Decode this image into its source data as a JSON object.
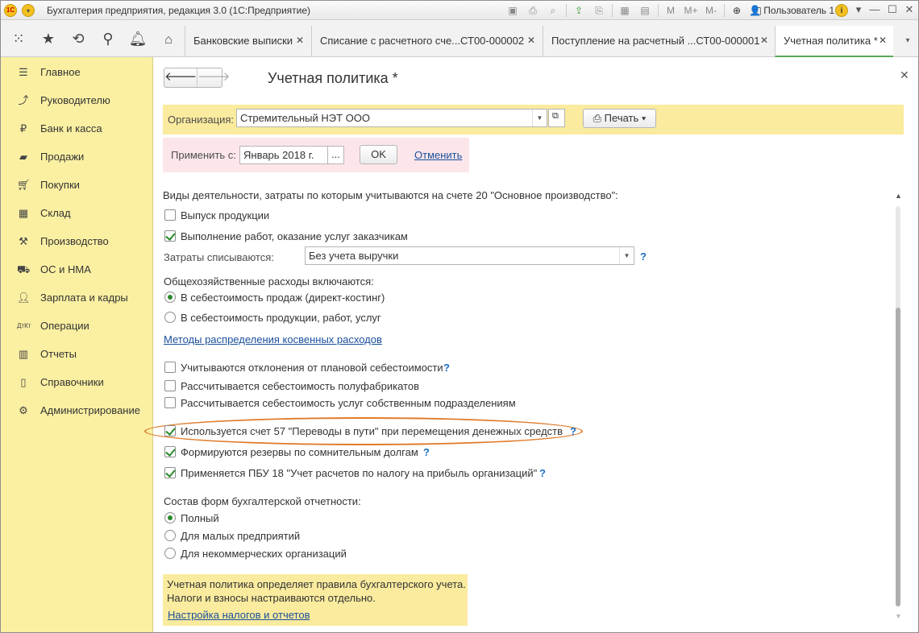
{
  "titlebar": {
    "logo": "1С",
    "title": "Бухгалтерия предприятия, редакция 3.0  (1С:Предприятие)",
    "user": "Пользователь 1",
    "icons": [
      "save-icon",
      "print-icon",
      "preview-icon",
      "upload-icon",
      "printer2-icon",
      "calculator-icon",
      "calendar-icon",
      "memory-m-icon",
      "memory-mplus-icon",
      "memory-mminus-icon",
      "zoom-icon",
      "window-icon"
    ],
    "memory_labels": [
      "M",
      "M+",
      "M-"
    ]
  },
  "navbar": {
    "tabs": [
      {
        "label": "Банковские выписки"
      },
      {
        "label": "Списание с расчетного сче...СТ00-000002"
      },
      {
        "label": "Поступление на расчетный ...СТ00-000001"
      },
      {
        "label": "Учетная политика *"
      }
    ]
  },
  "sidebar": {
    "items": [
      {
        "label": "Главное",
        "icon": "menu-icon"
      },
      {
        "label": "Руководителю",
        "icon": "chart-line-icon"
      },
      {
        "label": "Банк и касса",
        "icon": "ruble-icon"
      },
      {
        "label": "Продажи",
        "icon": "bag-icon"
      },
      {
        "label": "Покупки",
        "icon": "cart-icon"
      },
      {
        "label": "Склад",
        "icon": "warehouse-icon"
      },
      {
        "label": "Производство",
        "icon": "hammer-icon"
      },
      {
        "label": "ОС и НМА",
        "icon": "car-icon"
      },
      {
        "label": "Зарплата и кадры",
        "icon": "person-icon"
      },
      {
        "label": "Операции",
        "icon": "dt-kt-icon"
      },
      {
        "label": "Отчеты",
        "icon": "bar-chart-icon"
      },
      {
        "label": "Справочники",
        "icon": "book-icon"
      },
      {
        "label": "Администрирование",
        "icon": "gear-icon"
      }
    ]
  },
  "form": {
    "title": "Учетная политика *",
    "org_label": "Организация:",
    "org_value": "Стремительный НЭТ ООО",
    "print_label": "Печать",
    "apply_label": "Применить с:",
    "apply_value": "Январь 2018 г.",
    "ok_label": "OK",
    "cancel_label": "Отменить",
    "activities_header": "Виды деятельности, затраты по которым учитываются на счете 20 \"Основное производство\":",
    "cb_output": {
      "label": "Выпуск продукции",
      "checked": false
    },
    "cb_works": {
      "label": "Выполнение работ, оказание услуг заказчикам",
      "checked": true
    },
    "costs_label": "Затраты списываются:",
    "costs_value": "Без учета выручки",
    "overhead_header": "Общехозяйственные расходы включаются:",
    "rb_sales": {
      "label": "В себестоимость продаж (директ-костинг)",
      "checked": true
    },
    "rb_products": {
      "label": "В  себестоимость продукции, работ, услуг",
      "checked": false
    },
    "methods_link": "Методы распределения косвенных расходов",
    "cb_deviation": {
      "label": "Учитываются отклонения от плановой себестоимости",
      "checked": false
    },
    "cb_semi": {
      "label": "Рассчитывается себестоимость полуфабрикатов",
      "checked": false
    },
    "cb_own": {
      "label": "Рассчитывается себестоимость услуг собственным подразделениям",
      "checked": false
    },
    "cb_account57": {
      "label": "Используется счет 57 \"Переводы в пути\" при перемещения денежных средств",
      "checked": true
    },
    "cb_reserves": {
      "label": "Формируются резервы по сомнительным долгам",
      "checked": true
    },
    "cb_pbu18": {
      "label": "Применяется ПБУ 18 \"Учет расчетов по налогу на прибыль организаций\"",
      "checked": true
    },
    "reports_header": "Состав форм бухгалтерской отчетности:",
    "rb_full": {
      "label": "Полный",
      "checked": true
    },
    "rb_small": {
      "label": "Для малых предприятий",
      "checked": false
    },
    "rb_nonprofit": {
      "label": "Для некоммерческих организаций",
      "checked": false
    },
    "hint_line1": "Учетная политика определяет правила бухгалтерского учета.",
    "hint_line2": "Налоги и взносы настраиваются отдельно.",
    "hint_link": "Настройка налогов и отчетов",
    "help": "?"
  },
  "colors": {
    "sidebar_bg": "#fbf0a2",
    "org_bar_bg": "#faeb9e",
    "apply_bar_bg": "#fce6ea",
    "check_green": "#2a8a2a",
    "link_blue": "#1a4f9c",
    "highlight_orange": "#e07b2b"
  }
}
